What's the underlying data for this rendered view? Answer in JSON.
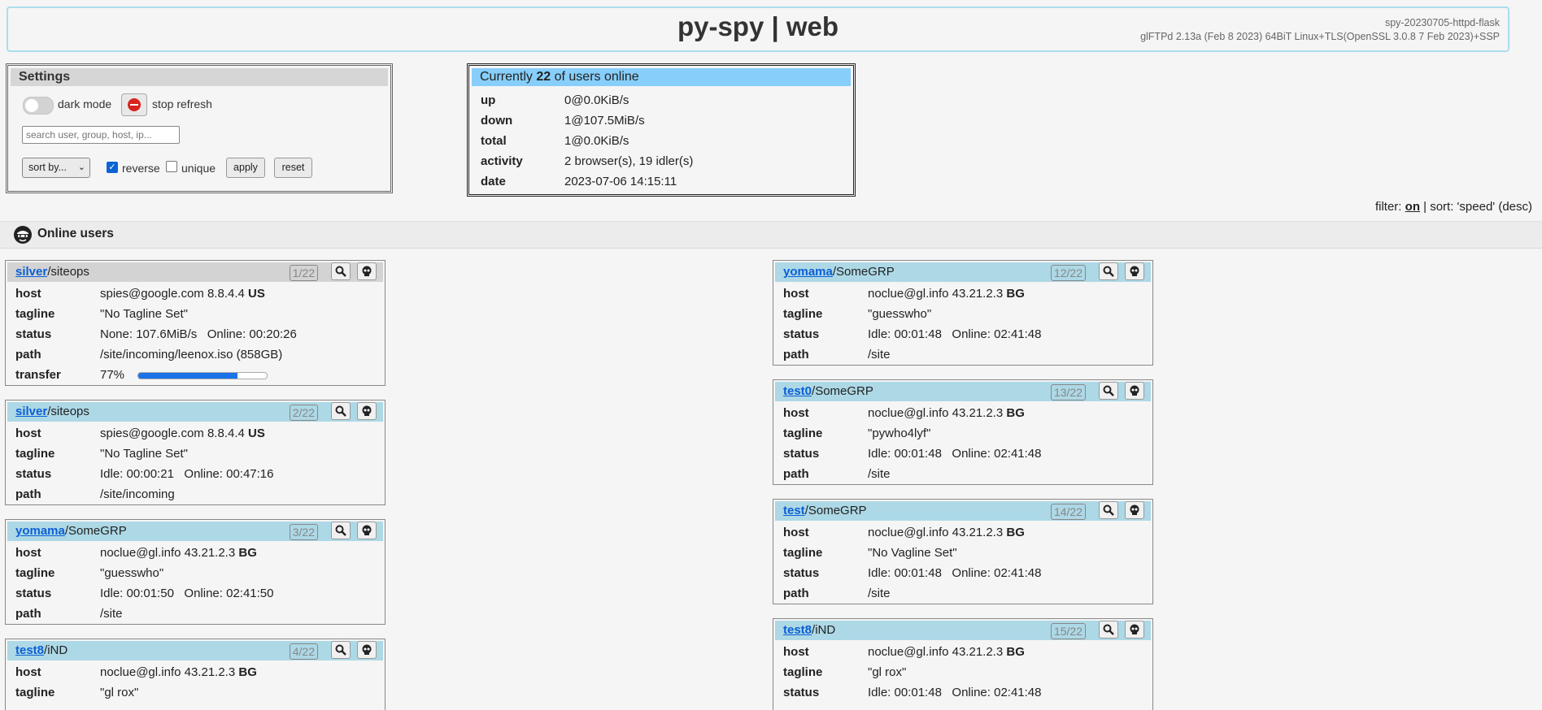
{
  "header": {
    "title": "py-spy | web",
    "version": "spy-20230705-httpd-flask",
    "server": "glFTPd 2.13a (Feb 8 2023) 64BiT Linux+TLS(OpenSSL 3.0.8 7 Feb 2023)+SSP"
  },
  "settings": {
    "title": "Settings",
    "dark_mode": "dark mode",
    "stop_refresh": "stop refresh",
    "search_placeholder": "search user, group, host, ip...",
    "sort_label": "sort by...",
    "reverse_label": "reverse",
    "reverse_checked": true,
    "unique_label": "unique",
    "unique_checked": false,
    "apply": "apply",
    "reset": "reset"
  },
  "stats": {
    "head_pre": "Currently ",
    "count": "22",
    "head_post": " of users online",
    "rows": [
      {
        "k": "up",
        "v": "0@0.0KiB/s"
      },
      {
        "k": "down",
        "v": "1@107.5MiB/s"
      },
      {
        "k": "total",
        "v": "1@0.0KiB/s"
      },
      {
        "k": "activity",
        "v": "2 browser(s), 19 idler(s)"
      },
      {
        "k": "date",
        "v": "2023-07-06 14:15:11"
      }
    ]
  },
  "filter": {
    "pre": "filter: ",
    "state": "on",
    "post": " | sort: 'speed' (desc)"
  },
  "online": {
    "title": "Online users"
  },
  "labels": {
    "host": "host",
    "tagline": "tagline",
    "status": "status",
    "path": "path",
    "transfer": "transfer"
  },
  "cards": [
    {
      "user": "silver",
      "group": "/siteops",
      "idx": "1/22",
      "host": "spies@google.com 8.8.4.4 ",
      "cc": "US",
      "tagline": "\"No Tagline Set\"",
      "status": "None: 107.6MiB/s   Online: 00:20:26",
      "path": "/site/incoming/leenox.iso (858GB)",
      "transfer": "77%",
      "transfer_frac": 0.77
    },
    {
      "user": "silver",
      "group": "/siteops",
      "idx": "2/22",
      "host": "spies@google.com 8.8.4.4 ",
      "cc": "US",
      "tagline": "\"No Tagline Set\"",
      "status": "Idle: 00:00:21   Online: 00:47:16",
      "path": "/site/incoming"
    },
    {
      "user": "yomama",
      "group": "/SomeGRP",
      "idx": "3/22",
      "host": "noclue@gl.info 43.21.2.3 ",
      "cc": "BG",
      "tagline": "\"guesswho\"",
      "status": "Idle: 00:01:50   Online: 02:41:50",
      "path": "/site"
    },
    {
      "user": "test8",
      "group": "/iND",
      "idx": "4/22",
      "host": "noclue@gl.info 43.21.2.3 ",
      "cc": "BG",
      "tagline": "\"gl rox\""
    },
    {
      "user": "yomama",
      "group": "/SomeGRP",
      "idx": "12/22",
      "host": "noclue@gl.info 43.21.2.3 ",
      "cc": "BG",
      "tagline": "\"guesswho\"",
      "status": "Idle: 00:01:48   Online: 02:41:48",
      "path": "/site"
    },
    {
      "user": "test0",
      "group": "/SomeGRP",
      "idx": "13/22",
      "host": "noclue@gl.info 43.21.2.3 ",
      "cc": "BG",
      "tagline": "\"pywho4lyf\"",
      "status": "Idle: 00:01:48   Online: 02:41:48",
      "path": "/site"
    },
    {
      "user": "test",
      "group": "/SomeGRP",
      "idx": "14/22",
      "host": "noclue@gl.info 43.21.2.3 ",
      "cc": "BG",
      "tagline": "\"No Vagline Set\"",
      "status": "Idle: 00:01:48   Online: 02:41:48",
      "path": "/site"
    },
    {
      "user": "test8",
      "group": "/iND",
      "idx": "15/22",
      "host": "noclue@gl.info 43.21.2.3 ",
      "cc": "BG",
      "tagline": "\"gl rox\"",
      "status": "Idle: 00:01:48   Online: 02:41:48"
    }
  ]
}
